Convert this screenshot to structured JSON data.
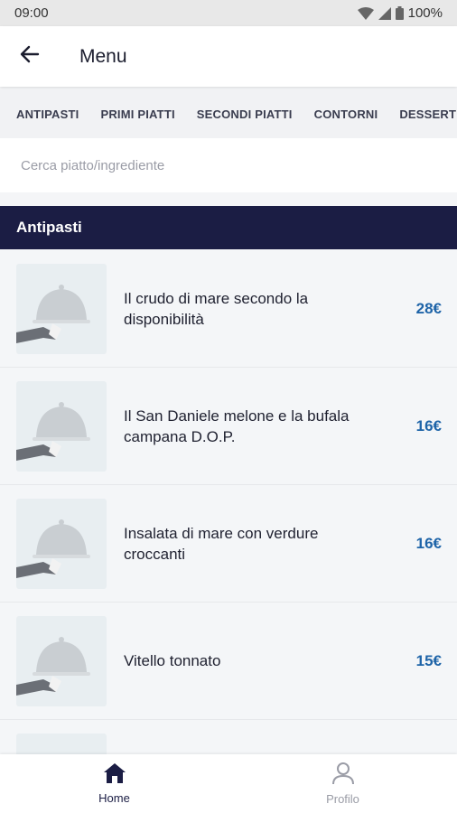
{
  "status_bar": {
    "time": "09:00",
    "battery": "100%"
  },
  "app_bar": {
    "title": "Menu"
  },
  "tabs": [
    {
      "label": "ANTIPASTI"
    },
    {
      "label": "PRIMI PIATTI"
    },
    {
      "label": "SECONDI PIATTI"
    },
    {
      "label": "CONTORNI"
    },
    {
      "label": "DESSERT"
    }
  ],
  "search": {
    "placeholder": "Cerca piatto/ingrediente"
  },
  "section": {
    "title": "Antipasti"
  },
  "dishes": [
    {
      "name": "Il crudo di mare secondo la disponibilità",
      "price": "28€"
    },
    {
      "name": "Il San Daniele melone e la bufala campana D.O.P.",
      "price": "16€"
    },
    {
      "name": "Insalata di mare con verdure croccanti",
      "price": "16€"
    },
    {
      "name": "Vitello tonnato",
      "price": "15€"
    },
    {
      "name": "",
      "price": ""
    }
  ],
  "bottom_nav": {
    "home_label": "Home",
    "profile_label": "Profilo"
  },
  "colors": {
    "accent_navy": "#1b1d44",
    "price_blue": "#1e64a8"
  }
}
